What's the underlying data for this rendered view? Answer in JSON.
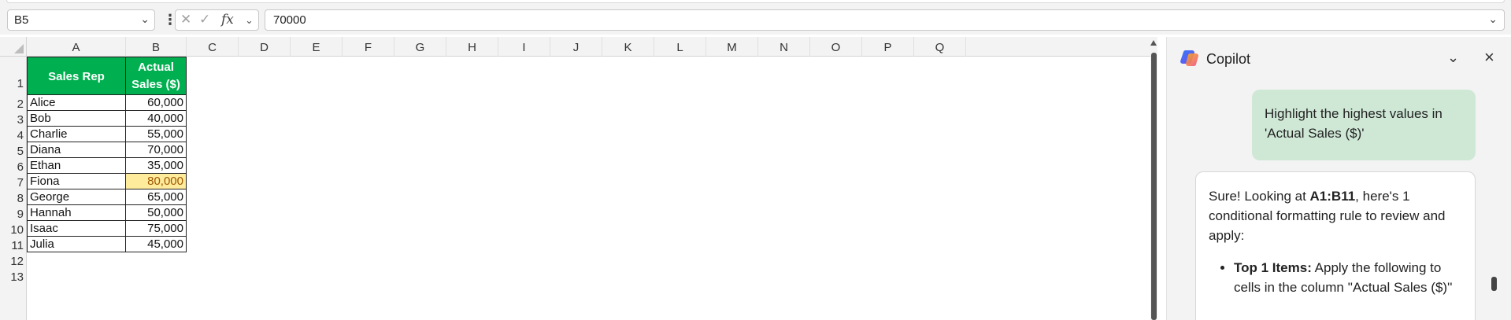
{
  "formula_bar": {
    "name_box": "B5",
    "formula": "70000",
    "fx_label": "fx"
  },
  "sheet": {
    "columns": [
      "A",
      "B",
      "C",
      "D",
      "E",
      "F",
      "G",
      "H",
      "I",
      "J",
      "K",
      "L",
      "M",
      "N",
      "O",
      "P",
      "Q"
    ],
    "rows": [
      "1",
      "2",
      "3",
      "4",
      "5",
      "6",
      "7",
      "8",
      "9",
      "10",
      "11",
      "12",
      "13"
    ],
    "table_header": [
      "Sales Rep",
      "Actual Sales ($)"
    ],
    "table_rows": [
      [
        "Alice",
        "60,000"
      ],
      [
        "Bob",
        "40,000"
      ],
      [
        "Charlie",
        "55,000"
      ],
      [
        "Diana",
        "70,000"
      ],
      [
        "Ethan",
        "35,000"
      ],
      [
        "Fiona",
        "80,000"
      ],
      [
        "George",
        "65,000"
      ],
      [
        "Hannah",
        "50,000"
      ],
      [
        "Isaac",
        "75,000"
      ],
      [
        "Julia",
        "45,000"
      ]
    ],
    "highlighted_row_index": 5,
    "colors": {
      "header_fill": "#00b050",
      "highlight_fill": "#ffeb9c",
      "highlight_text": "#9c5700"
    }
  },
  "copilot": {
    "title": "Copilot",
    "user_message": "Highlight the highest values in 'Actual Sales ($)'",
    "reply_intro_pre": "Sure! Looking at ",
    "reply_range": "A1:B11",
    "reply_intro_post": ", here's 1 conditional formatting rule to review and apply:",
    "reply_bullet_title": "Top 1 Items:",
    "reply_bullet_text": " Apply the following to cells in the column ''Actual Sales ($)''",
    "bubble_color": "#cfe8d6"
  }
}
